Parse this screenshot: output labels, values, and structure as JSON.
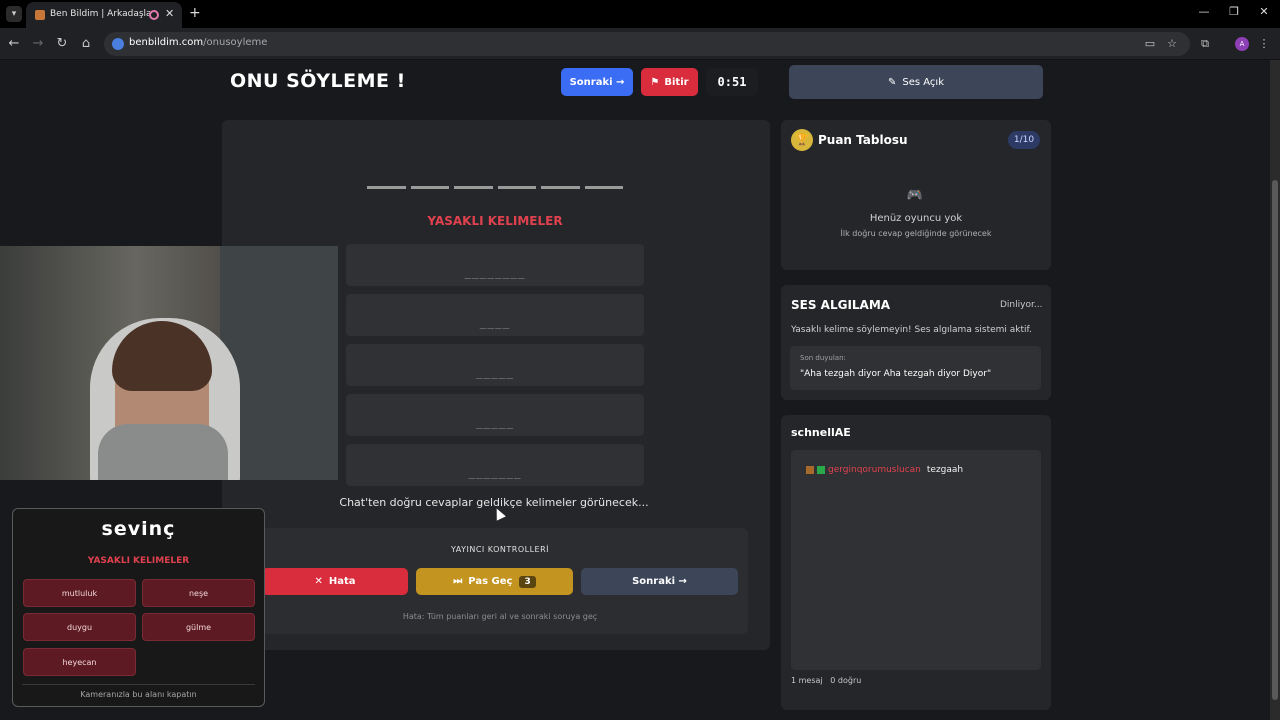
{
  "browser": {
    "tab_title": "Ben Bildim | Arkadaşlarınla",
    "url_domain": "benbildim.com",
    "url_path": "/onusoyleme",
    "avatar_letter": "A"
  },
  "header": {
    "title": "ONU SÖYLEME !",
    "next_label": "Sonraki →",
    "finish_label": "Bitir",
    "timer": "0:51"
  },
  "game": {
    "forbidden_title": "YASAKLI KELIMELER",
    "slots": [
      "________",
      "____",
      "_____",
      "_____",
      "_______"
    ],
    "chat_hint": "Chat'ten doğru cevaplar geldikçe kelimeler görünecek..."
  },
  "streamer_controls": {
    "label": "YAYINCI KONTROLLERİ",
    "error_label": "Hata",
    "pass_label": "Pas Geç",
    "pass_count": "3",
    "next_label": "Sonraki →",
    "help_text": "Hata: Tüm puanları geri al ve sonraki soruya geç"
  },
  "word_card": {
    "word": "sevinç",
    "forbidden_title": "YASAKLI KELIMELER",
    "words": [
      "mutluluk",
      "neşe",
      "duygu",
      "gülme",
      "heyecan"
    ],
    "footer": "Kameranızla bu alanı kapatın"
  },
  "sound": {
    "label": "Ses Açık"
  },
  "scoreboard": {
    "title": "Puan Tablosu",
    "count": "1/10",
    "empty_title": "Henüz oyuncu yok",
    "empty_sub": "İlk doğru cevap geldiğinde görünecek"
  },
  "voice": {
    "title": "SES ALGILAMA",
    "status": "Dinliyor...",
    "description": "Yasaklı kelime söylemeyin! Ses algılama sistemi aktif.",
    "heard_label": "Son duyulan:",
    "heard_text": "\"Aha tezgah diyor Aha tezgah diyor Diyor\""
  },
  "chat": {
    "username": "schnellAE",
    "message_user": "gerginqorumuslucan",
    "message_text": "tezgaah",
    "stats": "1 mesaj   0 doğru"
  },
  "colors": {
    "accent_blue": "#3b6cf4",
    "danger_red": "#d92c3c",
    "pass_gold": "#c49420",
    "forbidden_red": "#e0414e"
  }
}
